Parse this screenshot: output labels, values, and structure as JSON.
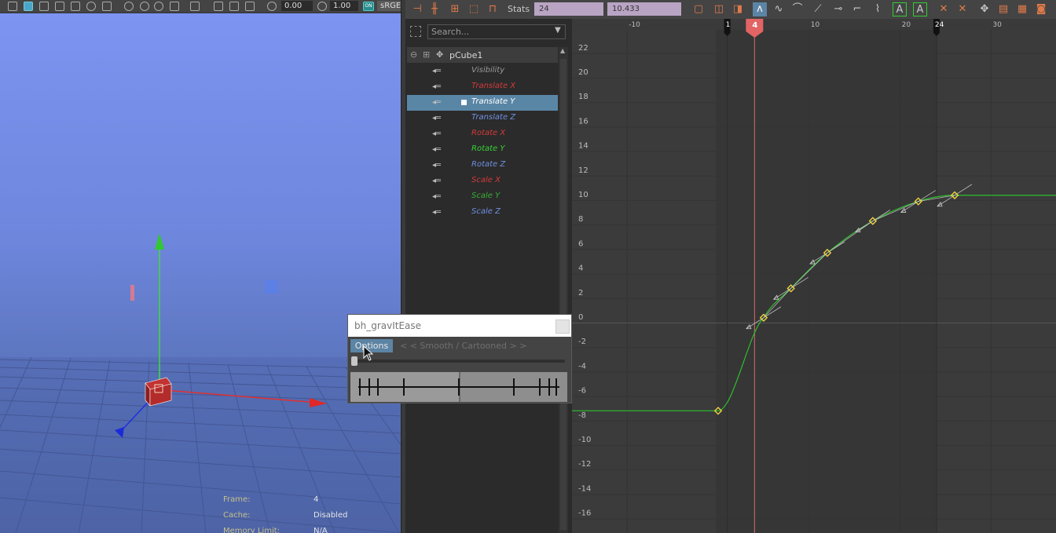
{
  "viewport": {
    "toolbar": {
      "field1_value": "0.00",
      "field2_value": "1.00",
      "colorspace_label": "sRGE",
      "toggle_label": "ON"
    },
    "hud": [
      {
        "label": "Frame:",
        "value": "4"
      },
      {
        "label": "Cache:",
        "value": "Disabled"
      },
      {
        "label": "Memory Limit:",
        "value": "N/A"
      }
    ]
  },
  "graph_editor": {
    "toolbar": {
      "stats_label": "Stats",
      "stats_value1": "24",
      "stats_value2": "10.433"
    },
    "search": {
      "placeholder": "Search..."
    },
    "outliner": {
      "object": "pCube1",
      "channels": [
        {
          "label": "Visibility",
          "color": "#9a9a9a",
          "selected": false
        },
        {
          "label": "Translate X",
          "color": "#d23a3a",
          "selected": false
        },
        {
          "label": "Translate Y",
          "color": "#ffffff",
          "selected": true
        },
        {
          "label": "Translate Z",
          "color": "#6f8fe0",
          "selected": false
        },
        {
          "label": "Rotate X",
          "color": "#d23a3a",
          "selected": false
        },
        {
          "label": "Rotate Y",
          "color": "#35d335",
          "selected": false
        },
        {
          "label": "Rotate Z",
          "color": "#6f8fe0",
          "selected": false
        },
        {
          "label": "Scale X",
          "color": "#d23a3a",
          "selected": false
        },
        {
          "label": "Scale Y",
          "color": "#35b035",
          "selected": false
        },
        {
          "label": "Scale Z",
          "color": "#6f8fe0",
          "selected": false
        }
      ]
    },
    "graph": {
      "x_ticks": [
        "-10",
        "10",
        "20",
        "30"
      ],
      "y_ticks": [
        "22",
        "20",
        "18",
        "16",
        "14",
        "12",
        "10",
        "8",
        "6",
        "4",
        "2",
        "0",
        "-2",
        "-4",
        "-6",
        "-8",
        "-10",
        "-12",
        "-14",
        "-16"
      ],
      "range_start": "1",
      "range_end": "24",
      "current_frame": "4",
      "keys": [
        {
          "frame": 0,
          "value": -7.2
        },
        {
          "frame": 5,
          "value": 0.4
        },
        {
          "frame": 8,
          "value": 2.8
        },
        {
          "frame": 12,
          "value": 5.7
        },
        {
          "frame": 17,
          "value": 8.3
        },
        {
          "frame": 22,
          "value": 9.9
        },
        {
          "frame": 26,
          "value": 10.4
        }
      ],
      "curve_color": "#2fbf2f"
    }
  },
  "dialog": {
    "title": "bh_gravItEase",
    "options_label": "Options",
    "mode_label": "< < Smooth / Cartooned > >",
    "slider_value": 0
  }
}
